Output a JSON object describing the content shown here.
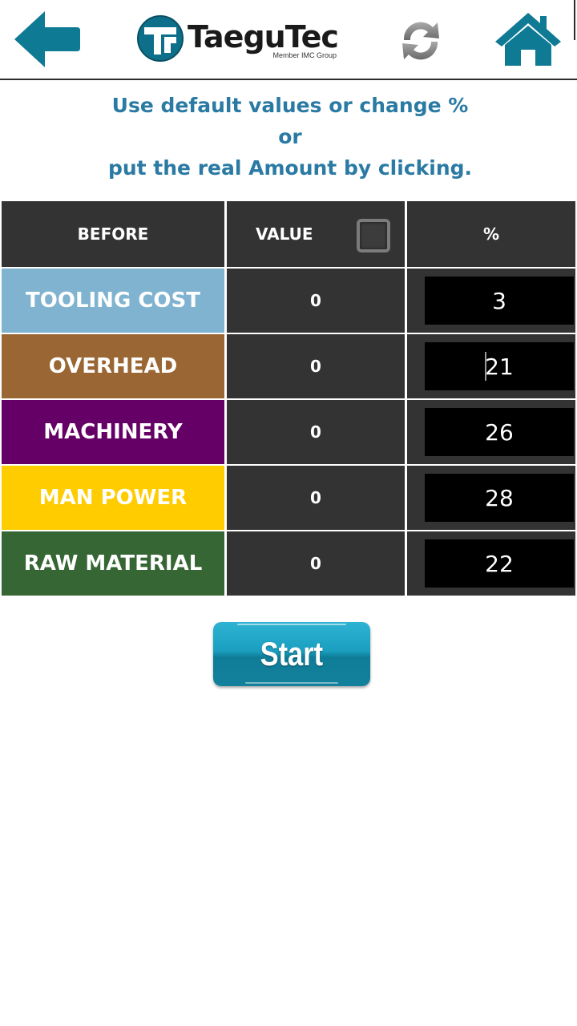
{
  "header": {
    "back_icon": "arrow-left-icon",
    "logo": {
      "name_part1": "Taegu",
      "name_part2": "Tec",
      "subtitle": "Member IMC Group"
    },
    "refresh_icon": "refresh-icon",
    "home_icon": "home-icon"
  },
  "instructions": {
    "line1": "Use default values or change %",
    "line2": "or",
    "line3": "put the real Amount by clicking."
  },
  "table": {
    "headers": {
      "before": "BEFORE",
      "value": "VALUE",
      "percent": "%"
    },
    "value_checkbox_checked": false,
    "rows": [
      {
        "label": "TOOLING COST",
        "value": "0",
        "percent": "3",
        "color": "#7fb3cf"
      },
      {
        "label": "OVERHEAD",
        "value": "0",
        "percent": "21",
        "color": "#9a6634"
      },
      {
        "label": "MACHINERY",
        "value": "0",
        "percent": "26",
        "color": "#650066"
      },
      {
        "label": "MAN POWER",
        "value": "0",
        "percent": "28",
        "color": "#ffcc00"
      },
      {
        "label": "RAW MATERIAL",
        "value": "0",
        "percent": "22",
        "color": "#356633"
      }
    ]
  },
  "start_button": {
    "label": "Start"
  },
  "colors": {
    "accent_teal": "#0e7a93",
    "instruction_text": "#2a7aa3",
    "table_dark": "#333333"
  }
}
